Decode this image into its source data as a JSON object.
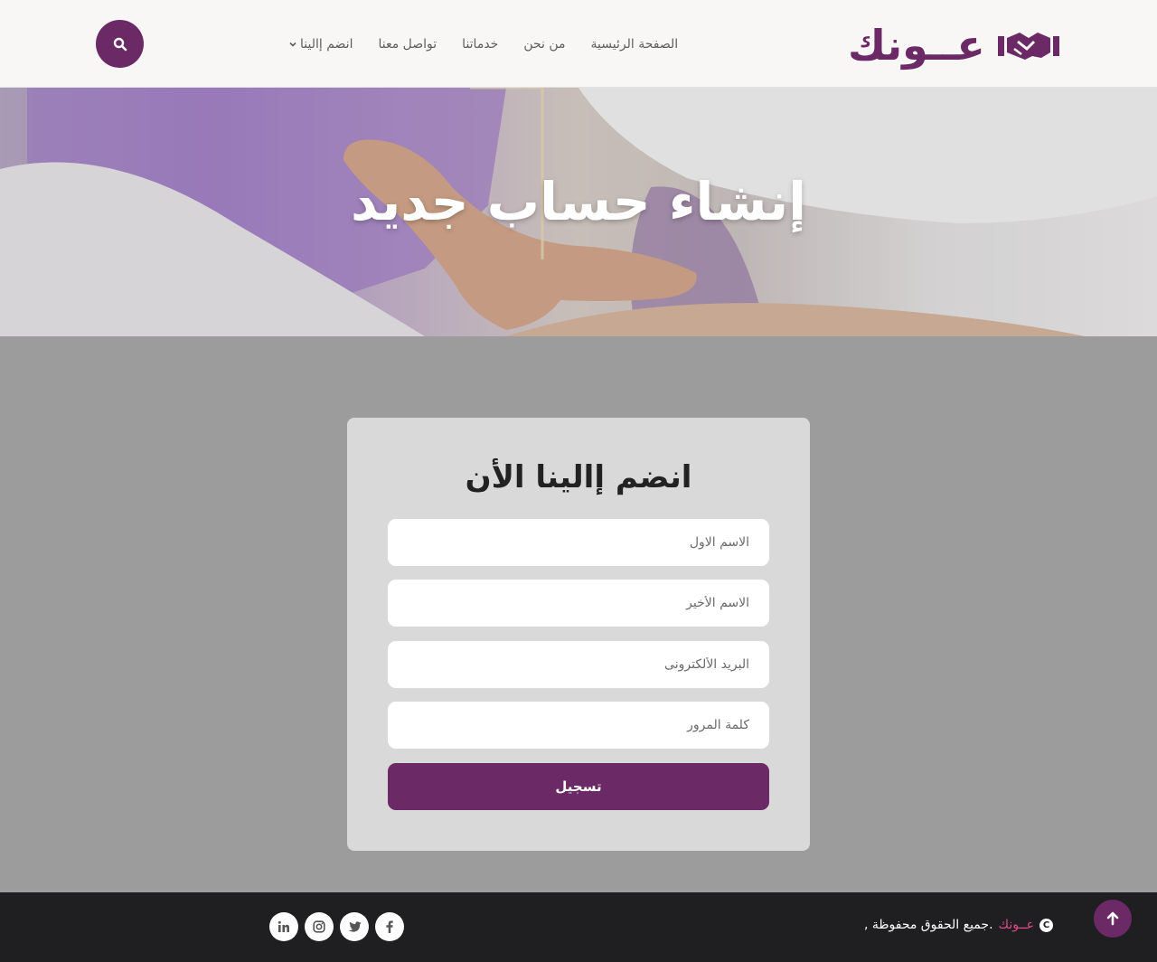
{
  "header": {
    "logo_text": "عــونك",
    "nav": [
      {
        "label": "الصفحة الرئيسية"
      },
      {
        "label": "من نحن"
      },
      {
        "label": "خدماتنا"
      },
      {
        "label": "تواصل معنا"
      },
      {
        "label": "انضم إالينا"
      }
    ]
  },
  "hero": {
    "title": "إنشاء حساب جديد"
  },
  "form": {
    "title": "انضم إالينا الأن",
    "first_name_placeholder": "الاسم الاول",
    "last_name_placeholder": "الاسم الأخير",
    "email_placeholder": "البريد الألكترونى",
    "password_placeholder": "كلمة المرور",
    "submit_label": "تسجيل"
  },
  "footer": {
    "brand": "عــونك",
    "rights_text": ", جميع الحقوق محفوظة.",
    "copyright_symbol": "C",
    "socials": [
      "linkedin-icon",
      "instagram-icon",
      "twitter-icon",
      "facebook-icon"
    ]
  },
  "colors": {
    "brand": "#6b2a66",
    "footer_bg": "#1f1e20",
    "accent_pink": "#e24a8a"
  }
}
